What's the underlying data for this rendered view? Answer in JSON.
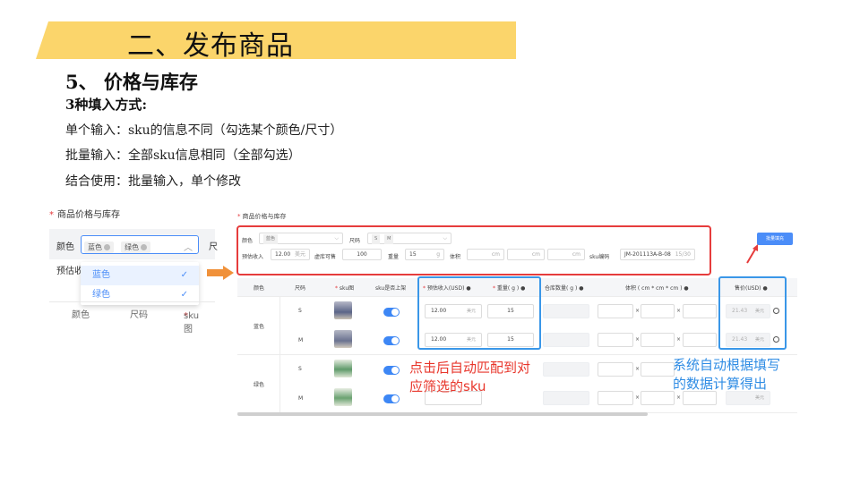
{
  "header": {
    "title": "二、发布商品"
  },
  "section": {
    "title": "5、 价格与库存",
    "subtitle": "3种填入方式:",
    "lines": [
      "单个输入：sku的信息不同（勾选某个颜色/尺寸）",
      "批量输入：全部sku信息相同（全部勾选）",
      "结合使用：批量输入，单个修改"
    ]
  },
  "left_panel": {
    "title": "商品价格与库存",
    "color_label": "颜色",
    "selected_tags": [
      "蓝色",
      "绿色"
    ],
    "size_label_partial": "尺",
    "estimate_label_partial": "预估收",
    "dropdown_options": [
      "蓝色",
      "绿色"
    ],
    "columns": [
      "颜色",
      "尺码",
      "sku图"
    ]
  },
  "batch_panel": {
    "title": "商品价格与库存",
    "color_label": "颜色",
    "color_tag": "蓝色",
    "size_label": "尺码",
    "size_tags": [
      "S",
      "M"
    ],
    "estimate_label": "预估收入",
    "estimate_value": "12.00",
    "estimate_unit": "美元",
    "stock_label": "虚库可售",
    "stock_value": "100",
    "weight_label": "重量",
    "weight_value": "15",
    "weight_unit": "g",
    "volume_label": "体积",
    "volume_unit": "cm",
    "sku_code_label": "sku编码",
    "sku_code_value": "JM-201113A-B-08",
    "sku_code_count": "15/30",
    "batch_button": "批量填充"
  },
  "table": {
    "headers": [
      "颜色",
      "尺码",
      "sku图",
      "sku是否上架",
      "预估收入(USD)",
      "重量( g )",
      "仓库数量( g )",
      "体积 ( cm * cm * cm )",
      "售价(USD)"
    ],
    "rows": [
      {
        "color": "蓝色",
        "size": "S",
        "estimate": "12.00",
        "estimate_unit": "美元",
        "weight": "15",
        "price": "21.43",
        "price_unit": "美元"
      },
      {
        "color": "",
        "size": "M",
        "estimate": "12.00",
        "estimate_unit": "美元",
        "weight": "15",
        "price": "21.43",
        "price_unit": "美元"
      },
      {
        "color": "绿色",
        "size": "S",
        "estimate": "",
        "estimate_unit": "",
        "weight": "",
        "price": "",
        "price_unit": ""
      },
      {
        "color": "",
        "size": "M",
        "estimate": "",
        "estimate_unit": "",
        "weight": "",
        "price": "",
        "price_unit": "美元"
      }
    ],
    "times_symbol": "×"
  },
  "annotations": {
    "red_line1": "点击后自动匹配到对",
    "red_line2": "应筛选的sku",
    "blue_line1": "系统自动根据填写",
    "blue_line2": "的数据计算得出"
  },
  "colors": {
    "banner": "#fbd56b",
    "accent_blue": "#4b8df8",
    "red": "#e63c3c",
    "highlight_blue": "#3a97e8"
  }
}
